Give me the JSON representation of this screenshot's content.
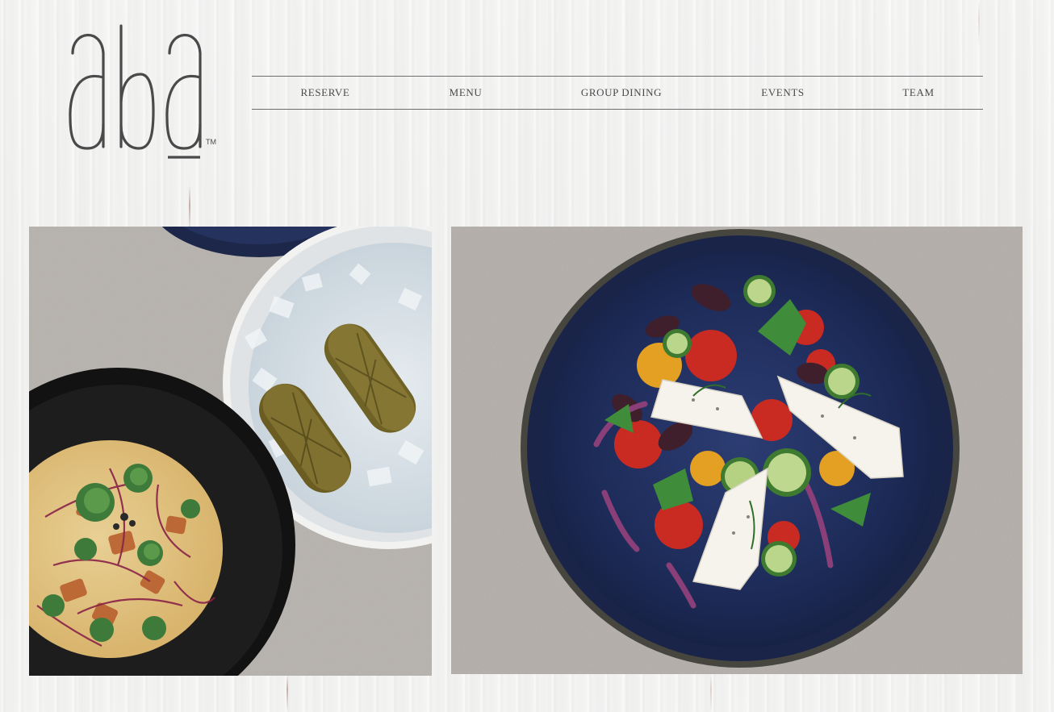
{
  "brand": {
    "logo_text": "aba",
    "trademark": "TM"
  },
  "nav": {
    "items": [
      {
        "label": "RESERVE"
      },
      {
        "label": "MENU"
      },
      {
        "label": "GROUP DINING"
      },
      {
        "label": "EVENTS"
      },
      {
        "label": "TEAM"
      }
    ]
  },
  "colors": {
    "text": "#4a4a4a",
    "rule": "#6e6e6e",
    "background": "#f4f4f3",
    "plate_navy": "#1f2f5c",
    "concrete": "#b5b1ac"
  },
  "icons": {
    "logo": "aba-logo",
    "photo_left": "dolmas-and-hummus-photo",
    "photo_right": "greek-salad-photo"
  }
}
